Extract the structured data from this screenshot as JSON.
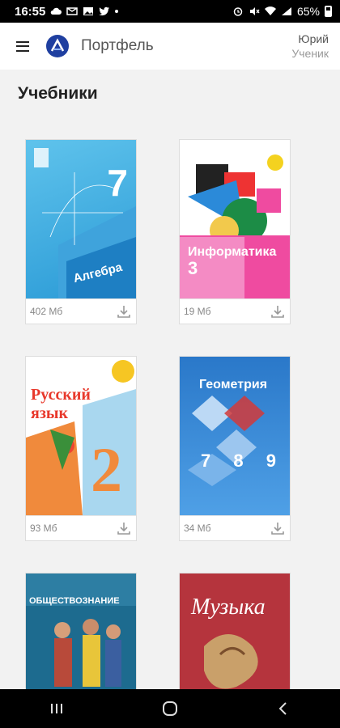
{
  "status_bar": {
    "time": "16:55",
    "battery": "65%"
  },
  "header": {
    "app_name": "Портфель",
    "user_name": "Юрий",
    "user_role": "Ученик"
  },
  "page_title": "Учебники",
  "books": [
    {
      "title": "Алгебра",
      "grade": "7",
      "size": "402 Мб"
    },
    {
      "title": "Информатика",
      "grade": "3",
      "size": "19 Мб"
    },
    {
      "title": "Русский язык",
      "grade": "2",
      "size": "93 Мб"
    },
    {
      "title": "Геометрия",
      "grade": "7 8 9",
      "size": "34 Мб"
    },
    {
      "title": "ОБЩЕСТВОЗНАНИЕ",
      "grade": "",
      "size": ""
    },
    {
      "title": "Музыка",
      "grade": "",
      "size": ""
    }
  ],
  "colors": {
    "accent": "#1f3fa0",
    "background": "#f2f2f2"
  },
  "icons": [
    "menu-icon",
    "logo-icon",
    "download-icon",
    "back-icon",
    "home-icon",
    "recents-icon"
  ]
}
